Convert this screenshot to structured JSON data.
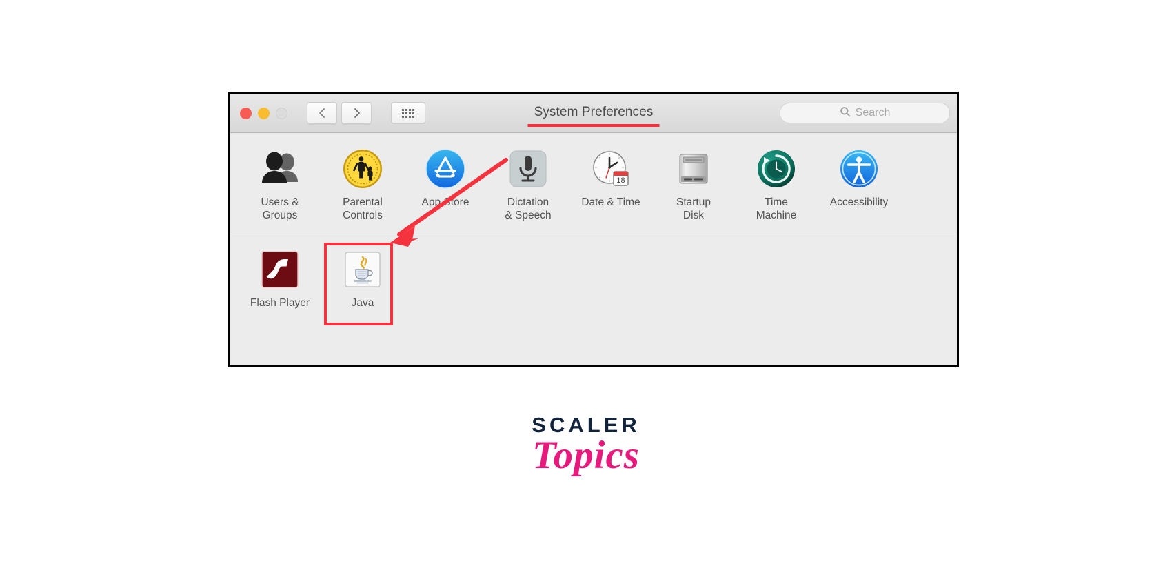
{
  "window": {
    "title": "System Preferences",
    "traffic_lights": [
      "close",
      "minimize",
      "zoom"
    ],
    "nav": {
      "back_label": "Back",
      "forward_label": "Forward",
      "grid_label": "Show All"
    },
    "search": {
      "placeholder": "Search",
      "value": "",
      "icon": "search-icon"
    }
  },
  "rows": [
    {
      "items": [
        {
          "label": "Users &\nGroups",
          "icon": "users-groups-icon"
        },
        {
          "label": "Parental\nControls",
          "icon": "parental-controls-icon"
        },
        {
          "label": "App Store",
          "icon": "app-store-icon"
        },
        {
          "label": "Dictation\n& Speech",
          "icon": "dictation-speech-icon"
        },
        {
          "label": "Date & Time",
          "icon": "date-time-icon"
        },
        {
          "label": "Startup\nDisk",
          "icon": "startup-disk-icon"
        },
        {
          "label": "Time\nMachine",
          "icon": "time-machine-icon"
        },
        {
          "label": "Accessibility",
          "icon": "accessibility-icon"
        }
      ]
    },
    {
      "items": [
        {
          "label": "Flash Player",
          "icon": "flash-player-icon"
        },
        {
          "label": "Java",
          "icon": "java-icon",
          "highlighted": true
        }
      ]
    }
  ],
  "annotations": {
    "title_underline_color": "#f5333f",
    "arrow_color": "#f5333f",
    "highlight_color": "#f5333f",
    "arrow_points_to": "Java",
    "underlines": "System Preferences"
  },
  "branding": {
    "name_top": "SCALER",
    "name_bottom": "Topics",
    "color_top": "#12233c",
    "color_bottom": "#e8197d"
  }
}
